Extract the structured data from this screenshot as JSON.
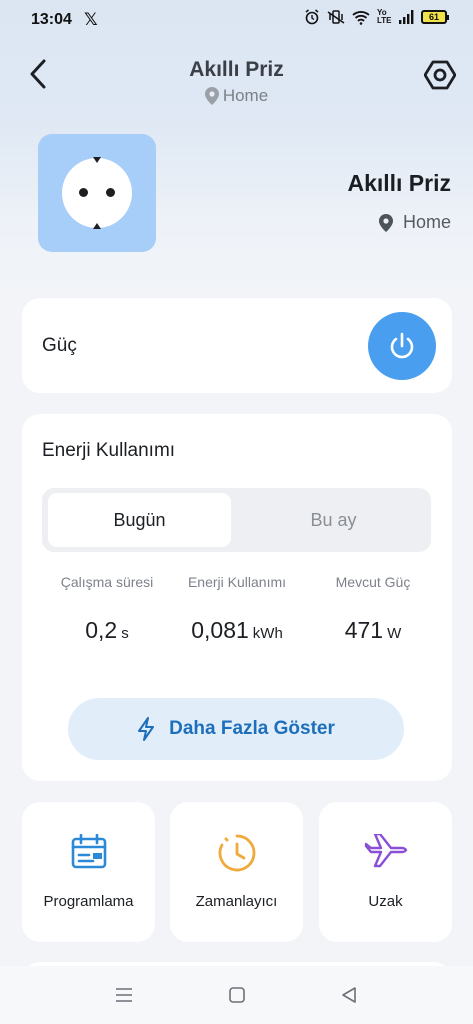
{
  "status_bar": {
    "time": "13:04",
    "x_logo": "𝕏",
    "network_label": "Yo LTE",
    "battery": "61"
  },
  "header": {
    "title": "Akıllı Priz",
    "location": "Home"
  },
  "device": {
    "name": "Akıllı Priz",
    "location": "Home",
    "tile_color": "#a7cdf9"
  },
  "power": {
    "label": "Güç",
    "button_color": "#4a9ef0"
  },
  "energy": {
    "title": "Enerji Kullanımı",
    "tabs": [
      {
        "label": "Bugün",
        "active": true
      },
      {
        "label": "Bu ay",
        "active": false
      }
    ],
    "stats": [
      {
        "label": "Çalışma süresi",
        "value": "0,2",
        "unit": "s"
      },
      {
        "label": "Enerji Kullanımı",
        "value": "0,081",
        "unit": "kWh"
      },
      {
        "label": "Mevcut Güç",
        "value": "471",
        "unit": "W"
      }
    ],
    "more_button": "Daha Fazla Göster"
  },
  "features": [
    {
      "label": "Programlama",
      "icon": "calendar-icon",
      "color": "#2a8ad8"
    },
    {
      "label": "Zamanlayıcı",
      "icon": "timer-icon",
      "color": "#f0a93b"
    },
    {
      "label": "Uzak",
      "icon": "airplane-icon",
      "color": "#8a4fd6"
    }
  ]
}
